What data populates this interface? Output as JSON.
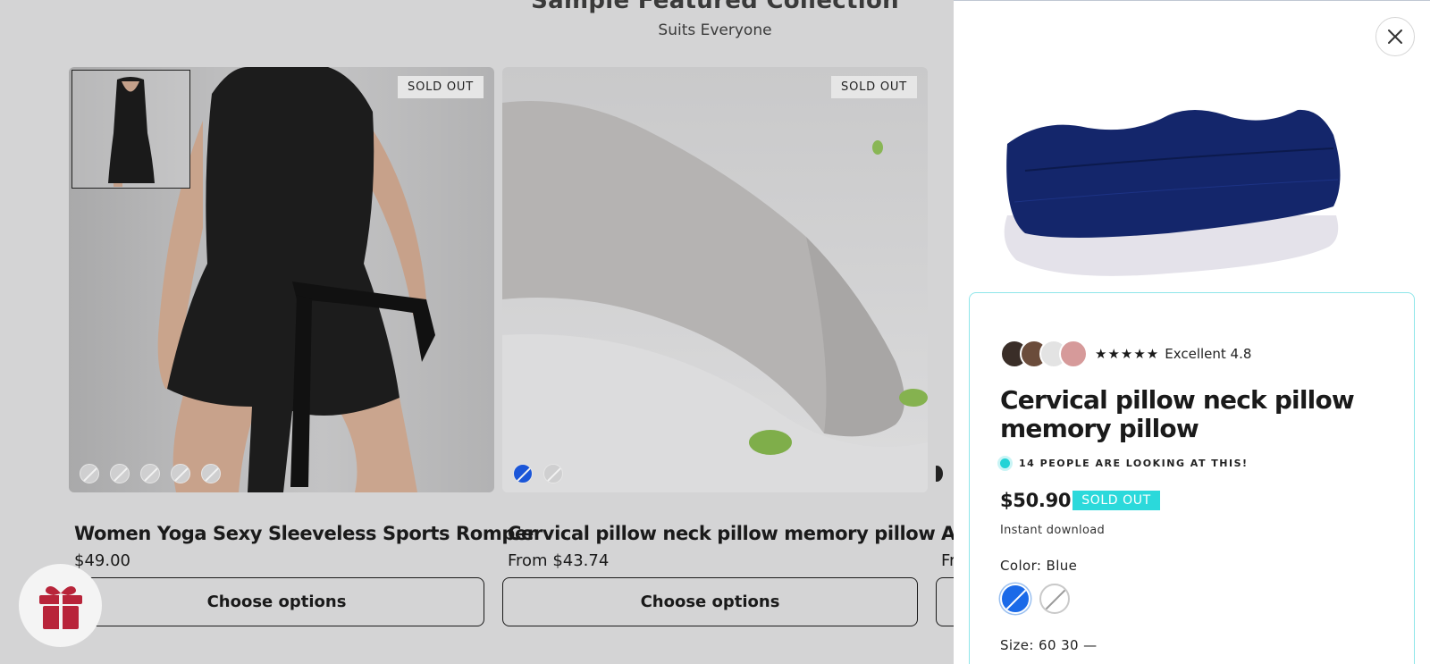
{
  "collection": {
    "heading": "Sample Featured Collection",
    "subheading": "Suits Everyone"
  },
  "products": [
    {
      "title": "Women Yoga Sexy Sleeveless Sports Romper",
      "price": "$49.00",
      "badge": "SOLD OUT",
      "button": "Choose options",
      "swatch_count": 5
    },
    {
      "title": "Cervical pillow neck pillow memory pillow",
      "price": "From $43.74",
      "badge": "SOLD OUT",
      "button": "Choose options"
    },
    {
      "title": "A",
      "price": "Fr"
    }
  ],
  "drawer": {
    "close_icon": "close-icon",
    "rating": {
      "stars": "★★★★★",
      "text": "Excellent 4.8"
    },
    "title": "Cervical pillow neck pillow memory pillow",
    "looking": "14 PEOPLE ARE LOOKING AT THIS!",
    "price": "$50.90",
    "sold_out": "SOLD OUT",
    "instant": "Instant download",
    "color_label": "Color: Blue",
    "colors": [
      "Blue",
      "White"
    ],
    "size_label": "Size: 60 30  —"
  },
  "colors": {
    "accent": "#2bd9db",
    "gift": "#b8243a",
    "pillow": "#14266b"
  }
}
